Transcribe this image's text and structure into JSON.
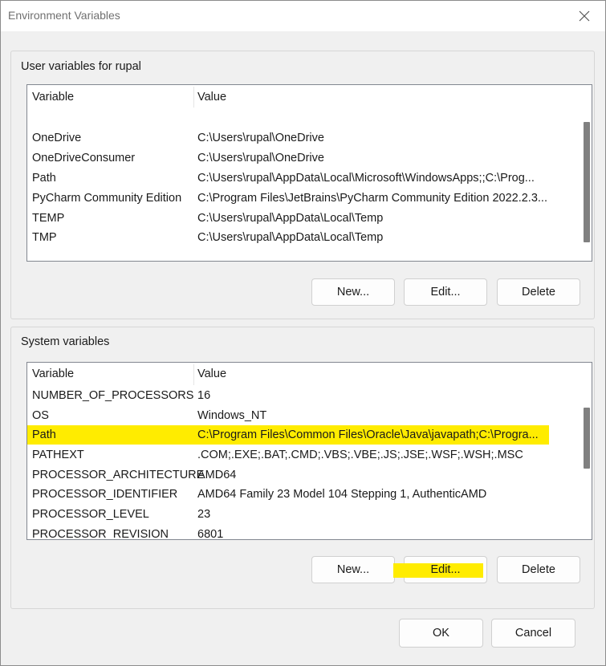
{
  "window": {
    "title": "Environment Variables",
    "close_icon": "close-icon"
  },
  "user_vars": {
    "label": "User variables for rupal",
    "headers": {
      "variable": "Variable",
      "value": "Value"
    },
    "rows": [
      {
        "name": "OneDrive",
        "value": "C:\\Users\\rupal\\OneDrive"
      },
      {
        "name": "OneDriveConsumer",
        "value": "C:\\Users\\rupal\\OneDrive"
      },
      {
        "name": "Path",
        "value": "C:\\Users\\rupal\\AppData\\Local\\Microsoft\\WindowsApps;;C:\\Prog..."
      },
      {
        "name": "PyCharm Community Edition",
        "value": "C:\\Program Files\\JetBrains\\PyCharm Community Edition 2022.2.3..."
      },
      {
        "name": "TEMP",
        "value": "C:\\Users\\rupal\\AppData\\Local\\Temp"
      },
      {
        "name": "TMP",
        "value": "C:\\Users\\rupal\\AppData\\Local\\Temp"
      }
    ],
    "buttons": {
      "new": "New...",
      "edit": "Edit...",
      "delete": "Delete"
    }
  },
  "system_vars": {
    "label": "System variables",
    "headers": {
      "variable": "Variable",
      "value": "Value"
    },
    "selected_row": "Path",
    "rows": [
      {
        "name": "NUMBER_OF_PROCESSORS",
        "value": "16"
      },
      {
        "name": "OS",
        "value": "Windows_NT"
      },
      {
        "name": "Path",
        "value": "C:\\Program Files\\Common Files\\Oracle\\Java\\javapath;C:\\Progra..."
      },
      {
        "name": "PATHEXT",
        "value": ".COM;.EXE;.BAT;.CMD;.VBS;.VBE;.JS;.JSE;.WSF;.WSH;.MSC"
      },
      {
        "name": "PROCESSOR_ARCHITECTURE",
        "value": "AMD64"
      },
      {
        "name": "PROCESSOR_IDENTIFIER",
        "value": "AMD64 Family 23 Model 104 Stepping 1, AuthenticAMD"
      },
      {
        "name": "PROCESSOR_LEVEL",
        "value": "23"
      },
      {
        "name": "PROCESSOR_REVISION",
        "value": "6801"
      }
    ],
    "buttons": {
      "new": "New...",
      "edit": "Edit...",
      "delete": "Delete"
    }
  },
  "footer": {
    "ok": "OK",
    "cancel": "Cancel"
  },
  "colors": {
    "highlight": "#ffec00",
    "background": "#f0f0f0"
  }
}
